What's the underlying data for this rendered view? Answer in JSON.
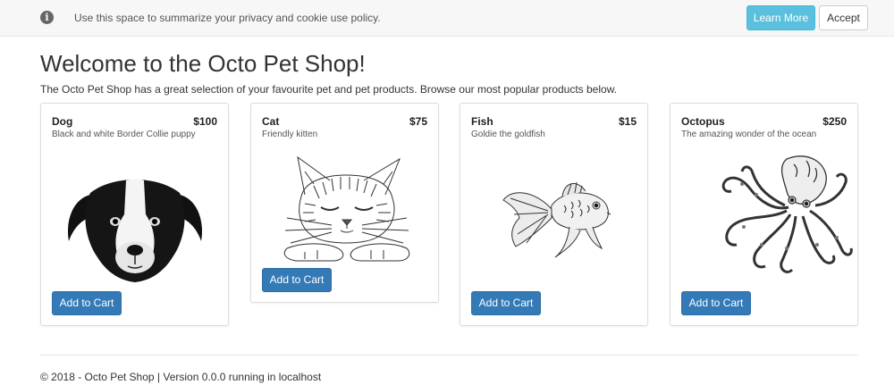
{
  "cookie_banner": {
    "icon": "info-icon",
    "message": "Use this space to summarize your privacy and cookie use policy.",
    "learn_more_label": "Learn More",
    "accept_label": "Accept"
  },
  "main": {
    "title": "Welcome to the Octo Pet Shop!",
    "intro": "The Octo Pet Shop has a great selection of your favourite pet and pet products. Browse our most popular products below."
  },
  "products": [
    {
      "name": "Dog",
      "price": "$100",
      "description": "Black and white Border Collie puppy",
      "image": "dog-illustration",
      "button_label": "Add to Cart"
    },
    {
      "name": "Cat",
      "price": "$75",
      "description": "Friendly kitten",
      "image": "cat-illustration",
      "button_label": "Add to Cart"
    },
    {
      "name": "Fish",
      "price": "$15",
      "description": "Goldie the goldfish",
      "image": "goldfish-illustration",
      "button_label": "Add to Cart"
    },
    {
      "name": "Octopus",
      "price": "$250",
      "description": "The amazing wonder of the ocean",
      "image": "octopus-illustration",
      "button_label": "Add to Cart"
    }
  ],
  "footer": {
    "text": "© 2018 - Octo Pet Shop | Version 0.0.0 running in localhost"
  },
  "colors": {
    "primary_button": "#337ab7",
    "info_button": "#5bc0de",
    "banner_background": "#f7f7f7"
  }
}
